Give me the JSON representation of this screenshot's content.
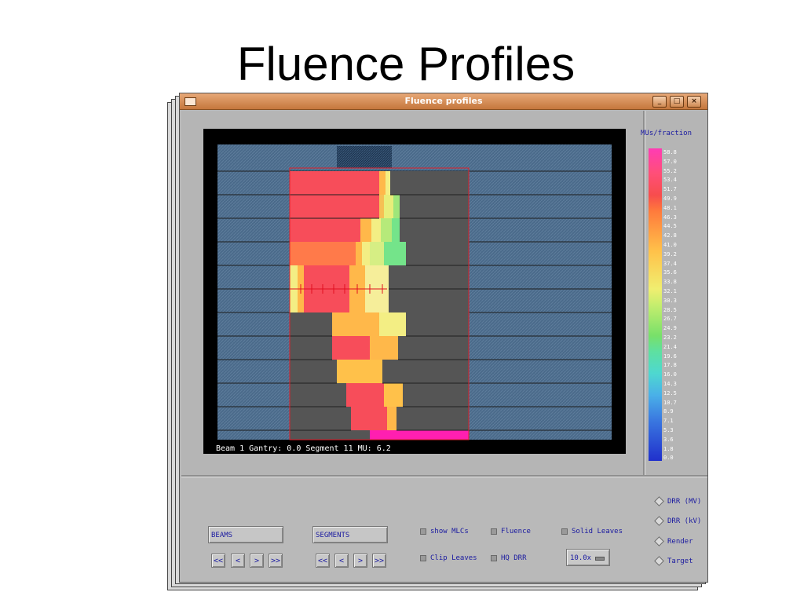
{
  "slide": {
    "title": "Fluence Profiles"
  },
  "window": {
    "title": "Fluence profiles",
    "controls": {
      "minimize": "_",
      "maximize": "□",
      "close": "×"
    }
  },
  "canvas": {
    "status": "Beam 1 Gantry: 0.0  Segment 11  MU: 6.2"
  },
  "scale": {
    "title": "MUs/fraction",
    "labels": [
      "58.8",
      "57.0",
      "55.2",
      "53.4",
      "51.7",
      "49.9",
      "48.1",
      "46.3",
      "44.5",
      "42.8",
      "41.0",
      "39.2",
      "37.4",
      "35.6",
      "33.8",
      "32.1",
      "30.3",
      "28.5",
      "26.7",
      "24.9",
      "23.2",
      "21.4",
      "19.6",
      "17.8",
      "16.0",
      "14.3",
      "12.5",
      "10.7",
      "8.9",
      "7.1",
      "5.3",
      "3.6",
      "1.8",
      "0.0"
    ]
  },
  "controls": {
    "beams_label": "BEAMS",
    "segments_label": "SEGMENTS",
    "nav": {
      "first": "<<",
      "prev": "<",
      "next": ">",
      "last": ">>"
    },
    "checkboxes": {
      "show_mlcs": "show MLCs",
      "fluence": "Fluence",
      "solid_leaves": "Solid Leaves",
      "clip_leaves": "Clip Leaves",
      "hq_drr": "HQ DRR"
    },
    "zoom_value": "10.0x",
    "radios": {
      "drr_mv": "DRR (MV)",
      "drr_kv": "DRR (kV)",
      "render": "Render",
      "target": "Target"
    }
  },
  "colors": {
    "titlebar": "#d9894d",
    "background": "#4a6a8a",
    "leaf": "#555555",
    "red": "#f74d5a",
    "orange": "#ff7a4a",
    "yellow": "#f3ee84",
    "green": "#74e48a",
    "magenta": "#ff1fb0"
  }
}
